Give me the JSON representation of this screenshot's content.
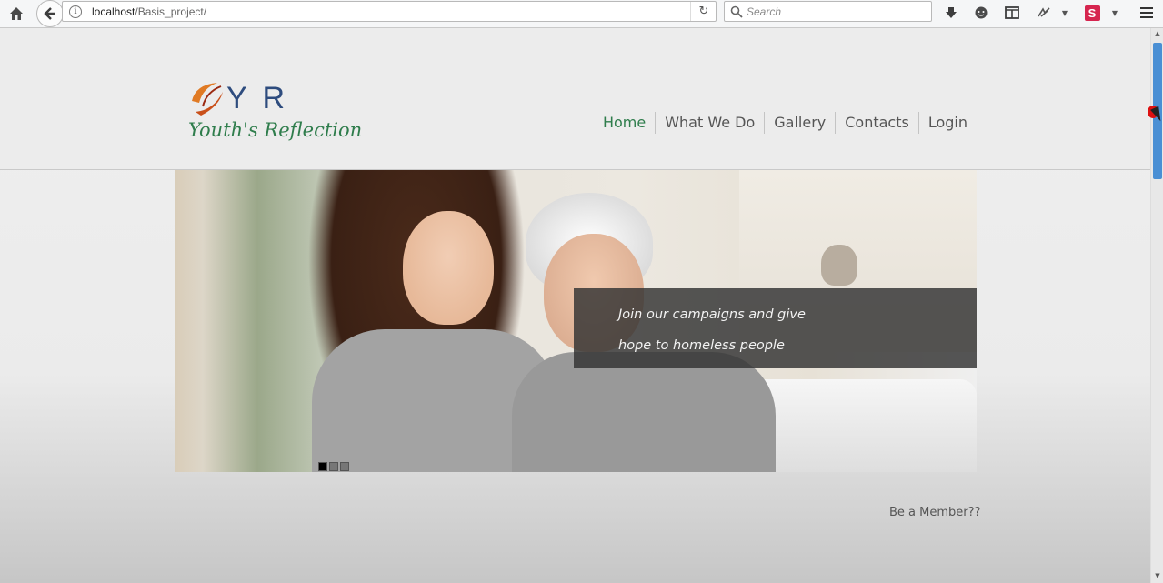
{
  "browser": {
    "url_host": "localhost",
    "url_path": "/Basis_project/",
    "search_placeholder": "Search",
    "s_badge": "S"
  },
  "site": {
    "logo_text": "Y R",
    "logo_tagline": "Youth's Reflection",
    "nav": [
      "Home",
      "What We Do",
      "Gallery",
      "Contacts",
      "Login"
    ],
    "active_nav": "Home",
    "slider": {
      "caption_line1": "Join our campaigns and give",
      "caption_line2": "hope to homeless people",
      "slide_count": 3,
      "active_slide": 1
    },
    "member_link": "Be a Member??"
  },
  "colors": {
    "brand_green": "#2f7d4c",
    "logo_blue": "#2e4c7e",
    "logo_orange": "#e07a24",
    "scroll_thumb": "#4a8fd4"
  }
}
